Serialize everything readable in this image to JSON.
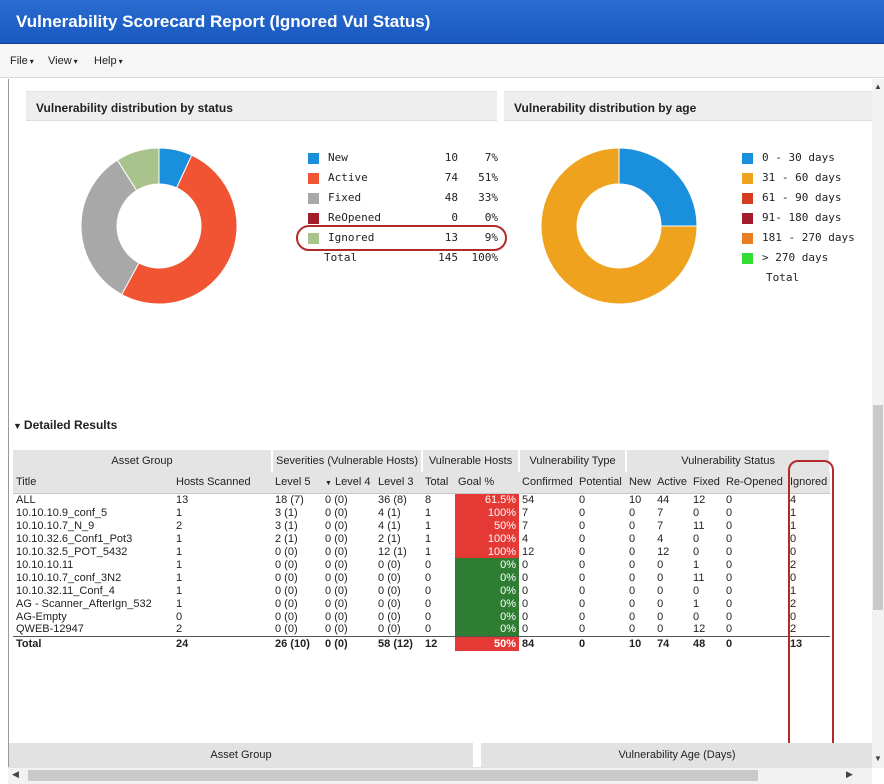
{
  "window": {
    "title": "Vulnerability Scorecard Report (Ignored Vul Status)"
  },
  "menu": [
    {
      "label": "File"
    },
    {
      "label": "View"
    },
    {
      "label": "Help"
    }
  ],
  "status_panel": {
    "title": "Vulnerability distribution by status",
    "legend": [
      {
        "label": "New",
        "count": "10",
        "pct": "7%",
        "color": "#1a8fdc"
      },
      {
        "label": "Active",
        "count": "74",
        "pct": "51%",
        "color": "#f05433"
      },
      {
        "label": "Fixed",
        "count": "48",
        "pct": "33%",
        "color": "#a8a8a8"
      },
      {
        "label": "ReOpened",
        "count": "0",
        "pct": "0%",
        "color": "#a31c2a"
      },
      {
        "label": "Ignored",
        "count": "13",
        "pct": "9%",
        "color": "#a8c48c"
      }
    ],
    "total": {
      "label": "Total",
      "count": "145",
      "pct": "100%"
    }
  },
  "age_panel": {
    "title": "Vulnerability distribution by age",
    "legend": [
      {
        "label": "0 - 30 days",
        "color": "#1a8fdc"
      },
      {
        "label": "31 - 60 days",
        "color": "#eea21e"
      },
      {
        "label": "61 - 90 days",
        "color": "#d63b1f"
      },
      {
        "label": "91- 180 days",
        "color": "#a31c2a"
      },
      {
        "label": "181 - 270 days",
        "color": "#ea7d24"
      },
      {
        "label": "> 270 days",
        "color": "#33dd33"
      }
    ],
    "total": {
      "label": "Total"
    }
  },
  "chart_data": [
    {
      "type": "pie",
      "variant": "donut",
      "categories": [
        "New",
        "Active",
        "Fixed",
        "ReOpened",
        "Ignored"
      ],
      "values": [
        10,
        74,
        48,
        0,
        13
      ],
      "colors": [
        "#1a8fdc",
        "#f05433",
        "#a8a8a8",
        "#a31c2a",
        "#a8c48c"
      ]
    },
    {
      "type": "pie",
      "variant": "donut",
      "categories": [
        "0 - 30 days",
        "31 - 60 days",
        "61 - 90 days",
        "91- 180 days",
        "181 - 270 days",
        "> 270 days"
      ],
      "values": [
        0.25,
        0.75,
        0,
        0,
        0,
        0
      ],
      "colors": [
        "#1a8fdc",
        "#eea21e",
        "#d63b1f",
        "#a31c2a",
        "#ea7d24",
        "#33dd33"
      ]
    }
  ],
  "detailed": {
    "label": "Detailed Results",
    "group_headers": [
      "Asset Group",
      "Severities (Vulnerable Hosts)",
      "Vulnerable Hosts",
      "Vulnerability Type",
      "Vulnerability Status"
    ],
    "columns": [
      "Title",
      "Hosts Scanned",
      "Level 5",
      "Level 4",
      "Level 3",
      "Total",
      "Goal %",
      "Confirmed",
      "Potential",
      "New",
      "Active",
      "Fixed",
      "Re-Opened",
      "Ignored"
    ],
    "sort_indicator": "▼",
    "rows": [
      {
        "title": "ALL",
        "hosts": "13",
        "l5": "18 (7)",
        "l4": "0 (0)",
        "l3": "36 (8)",
        "total": "8",
        "goal": "61.5%",
        "goal_color": "red",
        "confirmed": "54",
        "potential": "0",
        "new": "10",
        "active": "44",
        "fixed": "12",
        "reopened": "0",
        "ignored": "4"
      },
      {
        "title": "10.10.10.9_conf_5",
        "hosts": "1",
        "l5": "3 (1)",
        "l4": "0 (0)",
        "l3": "4 (1)",
        "total": "1",
        "goal": "100%",
        "goal_color": "red",
        "confirmed": "7",
        "potential": "0",
        "new": "0",
        "active": "7",
        "fixed": "0",
        "reopened": "0",
        "ignored": "1"
      },
      {
        "title": "10.10.10.7_N_9",
        "hosts": "2",
        "l5": "3 (1)",
        "l4": "0 (0)",
        "l3": "4 (1)",
        "total": "1",
        "goal": "50%",
        "goal_color": "red",
        "confirmed": "7",
        "potential": "0",
        "new": "0",
        "active": "7",
        "fixed": "11",
        "reopened": "0",
        "ignored": "1"
      },
      {
        "title": "10.10.32.6_Conf1_Pot3",
        "hosts": "1",
        "l5": "2 (1)",
        "l4": "0 (0)",
        "l3": "2 (1)",
        "total": "1",
        "goal": "100%",
        "goal_color": "red",
        "confirmed": "4",
        "potential": "0",
        "new": "0",
        "active": "4",
        "fixed": "0",
        "reopened": "0",
        "ignored": "0"
      },
      {
        "title": "10.10.32.5_POT_5432",
        "hosts": "1",
        "l5": "0 (0)",
        "l4": "0 (0)",
        "l3": "12 (1)",
        "total": "1",
        "goal": "100%",
        "goal_color": "red",
        "confirmed": "12",
        "potential": "0",
        "new": "0",
        "active": "12",
        "fixed": "0",
        "reopened": "0",
        "ignored": "0"
      },
      {
        "title": "10.10.10.11",
        "hosts": "1",
        "l5": "0 (0)",
        "l4": "0 (0)",
        "l3": "0 (0)",
        "total": "0",
        "goal": "0%",
        "goal_color": "green",
        "confirmed": "0",
        "potential": "0",
        "new": "0",
        "active": "0",
        "fixed": "1",
        "reopened": "0",
        "ignored": "2"
      },
      {
        "title": "10.10.10.7_conf_3N2",
        "hosts": "1",
        "l5": "0 (0)",
        "l4": "0 (0)",
        "l3": "0 (0)",
        "total": "0",
        "goal": "0%",
        "goal_color": "green",
        "confirmed": "0",
        "potential": "0",
        "new": "0",
        "active": "0",
        "fixed": "11",
        "reopened": "0",
        "ignored": "0"
      },
      {
        "title": "10.10.32.11_Conf_4",
        "hosts": "1",
        "l5": "0 (0)",
        "l4": "0 (0)",
        "l3": "0 (0)",
        "total": "0",
        "goal": "0%",
        "goal_color": "green",
        "confirmed": "0",
        "potential": "0",
        "new": "0",
        "active": "0",
        "fixed": "0",
        "reopened": "0",
        "ignored": "1"
      },
      {
        "title": "AG - Scanner_AfterIgn_532",
        "hosts": "1",
        "l5": "0 (0)",
        "l4": "0 (0)",
        "l3": "0 (0)",
        "total": "0",
        "goal": "0%",
        "goal_color": "green",
        "confirmed": "0",
        "potential": "0",
        "new": "0",
        "active": "0",
        "fixed": "1",
        "reopened": "0",
        "ignored": "2"
      },
      {
        "title": "AG-Empty",
        "hosts": "0",
        "l5": "0 (0)",
        "l4": "0 (0)",
        "l3": "0 (0)",
        "total": "0",
        "goal": "0%",
        "goal_color": "green",
        "confirmed": "0",
        "potential": "0",
        "new": "0",
        "active": "0",
        "fixed": "0",
        "reopened": "0",
        "ignored": "0"
      },
      {
        "title": "QWEB-12947",
        "hosts": "2",
        "l5": "0 (0)",
        "l4": "0 (0)",
        "l3": "0 (0)",
        "total": "0",
        "goal": "0%",
        "goal_color": "green",
        "confirmed": "0",
        "potential": "0",
        "new": "0",
        "active": "0",
        "fixed": "12",
        "reopened": "0",
        "ignored": "2"
      }
    ],
    "total_row": {
      "title": "Total",
      "hosts": "24",
      "l5": "26 (10)",
      "l4": "0 (0)",
      "l3": "58 (12)",
      "total": "12",
      "goal": "50%",
      "goal_color": "red",
      "confirmed": "84",
      "potential": "0",
      "new": "10",
      "active": "74",
      "fixed": "48",
      "reopened": "0",
      "ignored": "13"
    }
  },
  "bottom_headers": [
    "Asset Group",
    "Vulnerability Age (Days)"
  ]
}
